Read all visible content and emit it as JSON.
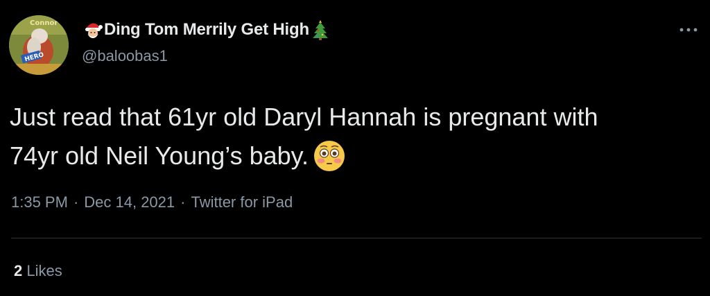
{
  "tweet": {
    "author": {
      "display_name": "Ding Tom Merrily Get High",
      "handle": "@baloobas1",
      "avatar_text": "Connor",
      "avatar_badge": "HERO",
      "name_prefix_icon": "santa-emoji-icon",
      "name_suffix_icon": "christmas-tree-emoji-icon"
    },
    "text_line1": "Just read that 61yr old Daryl Hannah is pregnant with",
    "text_line2": "74yr old Neil Young’s baby.",
    "text_emoji": "flushed-face-emoji-icon",
    "time": "1:35 PM",
    "date": "Dec 14, 2021",
    "source": "Twitter for iPad",
    "separator": "·",
    "likes_count": "2",
    "likes_label": "Likes",
    "more_icon": "more-options-icon"
  },
  "colors": {
    "background": "#000000",
    "primary_text": "#e7e9ea",
    "secondary_text": "#8b98a5",
    "divider": "#2f3336"
  }
}
